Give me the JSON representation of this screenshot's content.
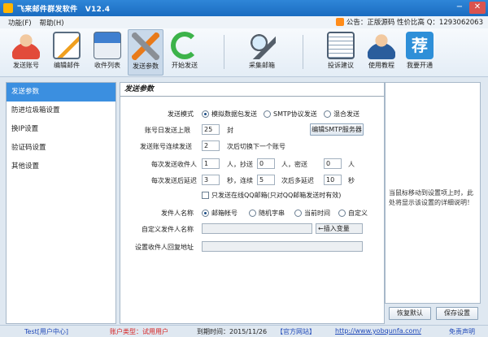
{
  "window": {
    "title": "飞来邮件群发软件　V12.4",
    "minimize": "−",
    "close": "✕"
  },
  "menu": {
    "items": [
      "功能(F)",
      "帮助(H)"
    ],
    "notice": "公告：正版源码 性价比高 Q：1293062063"
  },
  "toolbar": {
    "items": [
      {
        "label": "发送账号",
        "icon": "user-avatar-icon"
      },
      {
        "label": "编辑邮件",
        "icon": "edit-document-icon"
      },
      {
        "label": "收件列表",
        "icon": "mail-list-icon"
      },
      {
        "label": "发送参数",
        "icon": "tools-icon"
      },
      {
        "label": "开始发送",
        "icon": "refresh-icon"
      },
      {
        "label": "采集邮箱",
        "icon": "magnifier-icon"
      },
      {
        "label": "投诉建议",
        "icon": "notebook-icon"
      },
      {
        "label": "使用教程",
        "icon": "teacher-icon"
      },
      {
        "label": "我要开通",
        "icon": "recommend-icon"
      }
    ],
    "recommend_glyph": "荐"
  },
  "nav": {
    "items": [
      "发送参数",
      "防进垃圾箱设置",
      "换IP设置",
      "验证码设置",
      "其他设置"
    ]
  },
  "main": {
    "header": "发送参数",
    "send_mode_label": "发送模式",
    "send_mode_options": [
      "模拟数据包发送",
      "SMTP协议发送",
      "混合发送"
    ],
    "send_mode_selected": "模拟数据包发送",
    "daily_limit_label": "账号日发送上限",
    "daily_limit_value": "25",
    "daily_limit_unit": "封",
    "edit_smtp_button": "编辑SMTP服务器",
    "consecutive_label": "发送账号连续发送",
    "consecutive_value": "2",
    "consecutive_suffix": "次后切换下一个账号",
    "recipients_label": "每次发送收件人",
    "recipients_value": "1",
    "recipients_unit": "人，抄送",
    "cc_value": "0",
    "cc_unit": "人，密送",
    "bcc_value": "0",
    "bcc_unit": "人",
    "delay_label": "每次发送后延迟",
    "delay_value": "3",
    "delay_unit": "秒，连续",
    "consecutive_times_value": "5",
    "extra_delay_label": "次后多延迟",
    "extra_delay_value": "10",
    "extra_delay_unit": "秒",
    "qq_only_label": "只发送在线QQ邮箱(只对QQ邮箱发送时有效)",
    "sender_name_label": "发件人名称",
    "sender_name_options": [
      "邮箱帐号",
      "随机字串",
      "当前时间",
      "自定义"
    ],
    "sender_name_selected": "邮箱帐号",
    "custom_sender_label": "自定义发件人名称",
    "insert_variable_placeholder": "←插入变量",
    "reply_label": "设置收件人回复地址"
  },
  "right": {
    "tip": "当鼠标移动到设置项上时，此处将显示该设置的详细说明！"
  },
  "buttons": {
    "restore": "恢复默认",
    "save": "保存设置"
  },
  "status": {
    "user": "Test[用户中心]",
    "user_type": "账户类型：试用用户",
    "expiry": "到期时间：2015/11/26",
    "official_site": "【官方网站】",
    "url": "http://www.yobqunfa.com/",
    "disclaimer": "免责声明"
  },
  "colors": {
    "title_bar": "#1a6cc0",
    "nav_active": "#3b8fe0",
    "user_type_text": "#d62020",
    "status_link": "#1f48b8"
  }
}
